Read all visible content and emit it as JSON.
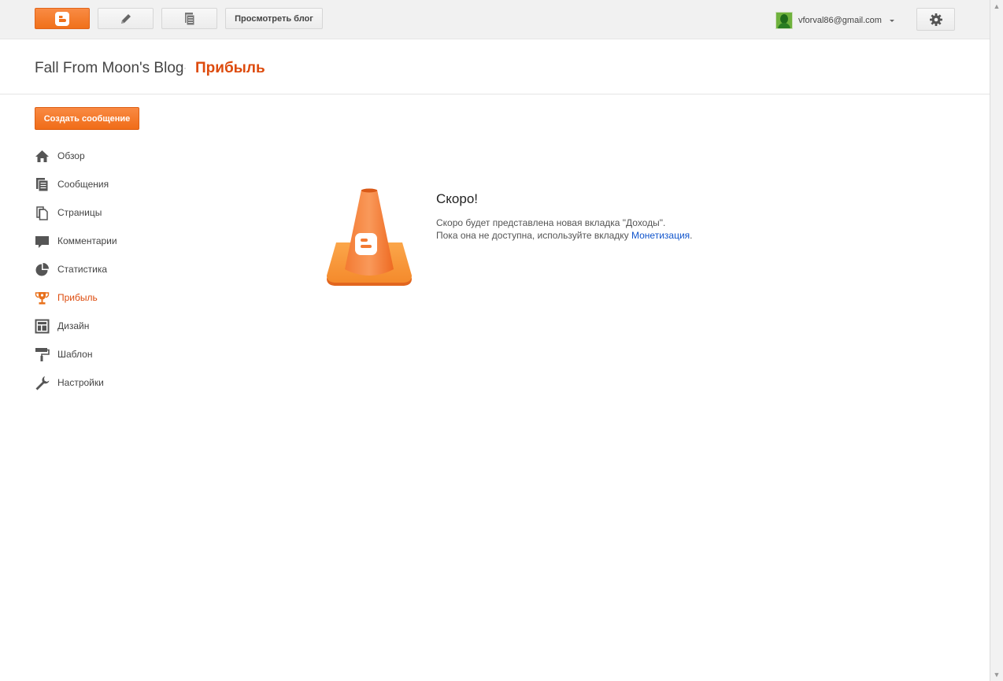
{
  "topbar": {
    "view_blog_label": "Просмотреть блог",
    "account_email": "vforval86@gmail.com"
  },
  "header": {
    "blog_title": "Fall From Moon's Blog",
    "separator": "·",
    "page_name": "Прибыль"
  },
  "sidebar": {
    "create_label": "Создать сообщение",
    "items": [
      {
        "label": "Обзор",
        "icon": "home-icon"
      },
      {
        "label": "Сообщения",
        "icon": "posts-icon"
      },
      {
        "label": "Страницы",
        "icon": "pages-icon"
      },
      {
        "label": "Комментарии",
        "icon": "comments-icon"
      },
      {
        "label": "Статистика",
        "icon": "stats-icon"
      },
      {
        "label": "Прибыль",
        "icon": "trophy-icon",
        "active": true
      },
      {
        "label": "Дизайн",
        "icon": "layout-icon"
      },
      {
        "label": "Шаблон",
        "icon": "template-icon"
      },
      {
        "label": "Настройки",
        "icon": "wrench-icon"
      }
    ]
  },
  "main": {
    "title": "Скоро!",
    "line1": "Скоро будет представлена новая вкладка \"Доходы\".",
    "line2_prefix": "Пока она не доступна, используйте вкладку ",
    "link_text": "Монетизация",
    "line2_suffix": "."
  },
  "colors": {
    "accent": "#dd4b0d",
    "button_orange": "#f37a2b",
    "link": "#1155cc"
  }
}
